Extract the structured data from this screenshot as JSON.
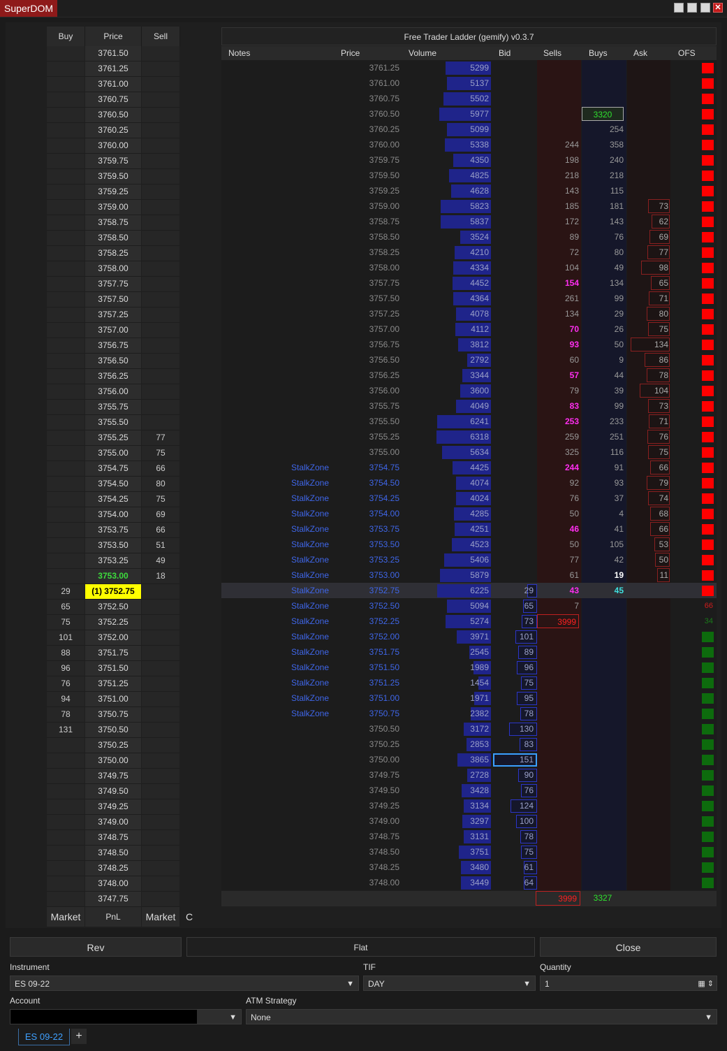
{
  "window": {
    "title": "SuperDOM",
    "ladder_title": "Free Trader Ladder (gemify) v0.3.7"
  },
  "left_ladder": {
    "headers": {
      "buy": "Buy",
      "price": "Price",
      "sell": "Sell"
    },
    "rows": [
      {
        "buy": "",
        "price": "3761.50",
        "sell": ""
      },
      {
        "buy": "",
        "price": "3761.25",
        "sell": ""
      },
      {
        "buy": "",
        "price": "3761.00",
        "sell": ""
      },
      {
        "buy": "",
        "price": "3760.75",
        "sell": ""
      },
      {
        "buy": "",
        "price": "3760.50",
        "sell": ""
      },
      {
        "buy": "",
        "price": "3760.25",
        "sell": ""
      },
      {
        "buy": "",
        "price": "3760.00",
        "sell": ""
      },
      {
        "buy": "",
        "price": "3759.75",
        "sell": ""
      },
      {
        "buy": "",
        "price": "3759.50",
        "sell": ""
      },
      {
        "buy": "",
        "price": "3759.25",
        "sell": ""
      },
      {
        "buy": "",
        "price": "3759.00",
        "sell": ""
      },
      {
        "buy": "",
        "price": "3758.75",
        "sell": ""
      },
      {
        "buy": "",
        "price": "3758.50",
        "sell": ""
      },
      {
        "buy": "",
        "price": "3758.25",
        "sell": ""
      },
      {
        "buy": "",
        "price": "3758.00",
        "sell": ""
      },
      {
        "buy": "",
        "price": "3757.75",
        "sell": ""
      },
      {
        "buy": "",
        "price": "3757.50",
        "sell": ""
      },
      {
        "buy": "",
        "price": "3757.25",
        "sell": ""
      },
      {
        "buy": "",
        "price": "3757.00",
        "sell": ""
      },
      {
        "buy": "",
        "price": "3756.75",
        "sell": ""
      },
      {
        "buy": "",
        "price": "3756.50",
        "sell": ""
      },
      {
        "buy": "",
        "price": "3756.25",
        "sell": ""
      },
      {
        "buy": "",
        "price": "3756.00",
        "sell": ""
      },
      {
        "buy": "",
        "price": "3755.75",
        "sell": ""
      },
      {
        "buy": "",
        "price": "3755.50",
        "sell": ""
      },
      {
        "buy": "",
        "price": "3755.25",
        "sell": "77"
      },
      {
        "buy": "",
        "price": "3755.00",
        "sell": "75"
      },
      {
        "buy": "",
        "price": "3754.75",
        "sell": "66"
      },
      {
        "buy": "",
        "price": "3754.50",
        "sell": "80"
      },
      {
        "buy": "",
        "price": "3754.25",
        "sell": "75"
      },
      {
        "buy": "",
        "price": "3754.00",
        "sell": "69"
      },
      {
        "buy": "",
        "price": "3753.75",
        "sell": "66"
      },
      {
        "buy": "",
        "price": "3753.50",
        "sell": "51"
      },
      {
        "buy": "",
        "price": "3753.25",
        "sell": "49"
      },
      {
        "buy": "",
        "price": "3753.00",
        "sell": "18",
        "style": "last"
      },
      {
        "buy": "29",
        "price": "(1) 3752.75",
        "sell": "",
        "style": "position"
      },
      {
        "buy": "65",
        "price": "3752.50",
        "sell": ""
      },
      {
        "buy": "75",
        "price": "3752.25",
        "sell": ""
      },
      {
        "buy": "101",
        "price": "3752.00",
        "sell": ""
      },
      {
        "buy": "88",
        "price": "3751.75",
        "sell": ""
      },
      {
        "buy": "96",
        "price": "3751.50",
        "sell": ""
      },
      {
        "buy": "76",
        "price": "3751.25",
        "sell": ""
      },
      {
        "buy": "94",
        "price": "3751.00",
        "sell": ""
      },
      {
        "buy": "78",
        "price": "3750.75",
        "sell": ""
      },
      {
        "buy": "131",
        "price": "3750.50",
        "sell": ""
      },
      {
        "buy": "",
        "price": "3750.25",
        "sell": ""
      },
      {
        "buy": "",
        "price": "3750.00",
        "sell": ""
      },
      {
        "buy": "",
        "price": "3749.75",
        "sell": ""
      },
      {
        "buy": "",
        "price": "3749.50",
        "sell": ""
      },
      {
        "buy": "",
        "price": "3749.25",
        "sell": ""
      },
      {
        "buy": "",
        "price": "3749.00",
        "sell": ""
      },
      {
        "buy": "",
        "price": "3748.75",
        "sell": ""
      },
      {
        "buy": "",
        "price": "3748.50",
        "sell": ""
      },
      {
        "buy": "",
        "price": "3748.25",
        "sell": ""
      },
      {
        "buy": "",
        "price": "3748.00",
        "sell": ""
      },
      {
        "buy": "",
        "price": "3747.75",
        "sell": ""
      }
    ],
    "footer": {
      "buy": "Market",
      "pnl": "PnL",
      "sell": "Market",
      "c": "C"
    }
  },
  "right_ladder": {
    "headers": {
      "notes": "Notes",
      "price": "Price",
      "volume": "Volume",
      "bid": "Bid",
      "sells": "Sells",
      "buys": "Buys",
      "ask": "Ask",
      "ofs": "OFS"
    },
    "rows": [
      {
        "note": "",
        "price": "3761.25",
        "volume": 5299,
        "bid": "",
        "sells": "",
        "buys": "",
        "ask": "",
        "ofs": "red"
      },
      {
        "note": "",
        "price": "3761.00",
        "volume": 5137,
        "bid": "",
        "sells": "",
        "buys": "",
        "ask": "",
        "ofs": "red"
      },
      {
        "note": "",
        "price": "3760.75",
        "volume": 5502,
        "bid": "",
        "sells": "",
        "buys": "",
        "ask": "",
        "ofs": "red"
      },
      {
        "note": "",
        "price": "3760.50",
        "volume": 5977,
        "bid": "",
        "sells": "",
        "buys": "3320",
        "ask": "",
        "ofs": "red",
        "buysStyle": "boxgreen"
      },
      {
        "note": "",
        "price": "3760.25",
        "volume": 5099,
        "bid": "",
        "sells": "",
        "buys": "254",
        "ask": "",
        "ofs": "red"
      },
      {
        "note": "",
        "price": "3760.00",
        "volume": 5338,
        "bid": "",
        "sells": "244",
        "buys": "358",
        "ask": "",
        "ofs": "red"
      },
      {
        "note": "",
        "price": "3759.75",
        "volume": 4350,
        "bid": "",
        "sells": "198",
        "buys": "240",
        "ask": "",
        "ofs": "red"
      },
      {
        "note": "",
        "price": "3759.50",
        "volume": 4825,
        "bid": "",
        "sells": "218",
        "buys": "218",
        "ask": "",
        "ofs": "red"
      },
      {
        "note": "",
        "price": "3759.25",
        "volume": 4628,
        "bid": "",
        "sells": "143",
        "buys": "115",
        "ask": "",
        "ofs": "red"
      },
      {
        "note": "",
        "price": "3759.00",
        "volume": 5823,
        "bid": "",
        "sells": "185",
        "buys": "181",
        "ask": "73",
        "ofs": "red"
      },
      {
        "note": "",
        "price": "3758.75",
        "volume": 5837,
        "bid": "",
        "sells": "172",
        "buys": "143",
        "ask": "62",
        "ofs": "red"
      },
      {
        "note": "",
        "price": "3758.50",
        "volume": 3524,
        "bid": "",
        "sells": "89",
        "buys": "76",
        "ask": "69",
        "ofs": "red"
      },
      {
        "note": "",
        "price": "3758.25",
        "volume": 4210,
        "bid": "",
        "sells": "72",
        "buys": "80",
        "ask": "77",
        "ofs": "red"
      },
      {
        "note": "",
        "price": "3758.00",
        "volume": 4334,
        "bid": "",
        "sells": "104",
        "buys": "49",
        "ask": "98",
        "ofs": "red"
      },
      {
        "note": "",
        "price": "3757.75",
        "volume": 4452,
        "bid": "",
        "sells": "154",
        "buys": "134",
        "ask": "65",
        "ofs": "red",
        "sellsStyle": "magenta"
      },
      {
        "note": "",
        "price": "3757.50",
        "volume": 4364,
        "bid": "",
        "sells": "261",
        "buys": "99",
        "ask": "71",
        "ofs": "red"
      },
      {
        "note": "",
        "price": "3757.25",
        "volume": 4078,
        "bid": "",
        "sells": "134",
        "buys": "29",
        "ask": "80",
        "ofs": "red"
      },
      {
        "note": "",
        "price": "3757.00",
        "volume": 4112,
        "bid": "",
        "sells": "70",
        "buys": "26",
        "ask": "75",
        "ofs": "red",
        "sellsStyle": "magenta"
      },
      {
        "note": "",
        "price": "3756.75",
        "volume": 3812,
        "bid": "",
        "sells": "93",
        "buys": "50",
        "ask": "134",
        "ofs": "red",
        "sellsStyle": "magenta"
      },
      {
        "note": "",
        "price": "3756.50",
        "volume": 2792,
        "bid": "",
        "sells": "60",
        "buys": "9",
        "ask": "86",
        "ofs": "red"
      },
      {
        "note": "",
        "price": "3756.25",
        "volume": 3344,
        "bid": "",
        "sells": "57",
        "buys": "44",
        "ask": "78",
        "ofs": "red",
        "sellsStyle": "magenta"
      },
      {
        "note": "",
        "price": "3756.00",
        "volume": 3600,
        "bid": "",
        "sells": "79",
        "buys": "39",
        "ask": "104",
        "ofs": "red"
      },
      {
        "note": "",
        "price": "3755.75",
        "volume": 4049,
        "bid": "",
        "sells": "83",
        "buys": "99",
        "ask": "73",
        "ofs": "red",
        "sellsStyle": "magenta"
      },
      {
        "note": "",
        "price": "3755.50",
        "volume": 6241,
        "bid": "",
        "sells": "253",
        "buys": "233",
        "ask": "71",
        "ofs": "red",
        "sellsStyle": "magenta"
      },
      {
        "note": "",
        "price": "3755.25",
        "volume": 6318,
        "bid": "",
        "sells": "259",
        "buys": "251",
        "ask": "76",
        "ofs": "red"
      },
      {
        "note": "",
        "price": "3755.00",
        "volume": 5634,
        "bid": "",
        "sells": "325",
        "buys": "116",
        "ask": "75",
        "ofs": "red"
      },
      {
        "note": "StalkZone",
        "price": "3754.75",
        "volume": 4425,
        "bid": "",
        "sells": "244",
        "buys": "91",
        "ask": "66",
        "ofs": "red",
        "sellsStyle": "magenta"
      },
      {
        "note": "StalkZone",
        "price": "3754.50",
        "volume": 4074,
        "bid": "",
        "sells": "92",
        "buys": "93",
        "ask": "79",
        "ofs": "red"
      },
      {
        "note": "StalkZone",
        "price": "3754.25",
        "volume": 4024,
        "bid": "",
        "sells": "76",
        "buys": "37",
        "ask": "74",
        "ofs": "red"
      },
      {
        "note": "StalkZone",
        "price": "3754.00",
        "volume": 4285,
        "bid": "",
        "sells": "50",
        "buys": "4",
        "ask": "68",
        "ofs": "red"
      },
      {
        "note": "StalkZone",
        "price": "3753.75",
        "volume": 4251,
        "bid": "",
        "sells": "46",
        "buys": "41",
        "ask": "66",
        "ofs": "red",
        "sellsStyle": "magenta"
      },
      {
        "note": "StalkZone",
        "price": "3753.50",
        "volume": 4523,
        "bid": "",
        "sells": "50",
        "buys": "105",
        "ask": "53",
        "ofs": "red"
      },
      {
        "note": "StalkZone",
        "price": "3753.25",
        "volume": 5406,
        "bid": "",
        "sells": "77",
        "buys": "42",
        "ask": "50",
        "ofs": "red"
      },
      {
        "note": "StalkZone",
        "price": "3753.00",
        "volume": 5879,
        "bid": "",
        "sells": "61",
        "buys": "19",
        "ask": "11",
        "ofs": "red",
        "buysStyle": "white"
      },
      {
        "note": "StalkZone",
        "price": "3752.75",
        "volume": 6225,
        "bid": "29",
        "sells": "43",
        "buys": "45",
        "ask": "",
        "ofs": "red",
        "sellsStyle": "magenta",
        "buysStyle": "cyan",
        "rowStyle": "current"
      },
      {
        "note": "StalkZone",
        "price": "3752.50",
        "volume": 5094,
        "bid": "65",
        "sells": "7",
        "buys": "",
        "ask": "",
        "ofs": "66",
        "ofsColor": "red"
      },
      {
        "note": "StalkZone",
        "price": "3752.25",
        "volume": 5274,
        "bid": "73",
        "sells": "3999",
        "buys": "",
        "ask": "",
        "ofs": "34",
        "ofsColor": "green",
        "sellsStyle": "boxred"
      },
      {
        "note": "StalkZone",
        "price": "3752.00",
        "volume": 3971,
        "bid": "101",
        "sells": "",
        "buys": "",
        "ask": "",
        "ofs": "green"
      },
      {
        "note": "StalkZone",
        "price": "3751.75",
        "volume": 2545,
        "bid": "89",
        "sells": "",
        "buys": "",
        "ask": "",
        "ofs": "green"
      },
      {
        "note": "StalkZone",
        "price": "3751.50",
        "volume": 1989,
        "bid": "96",
        "sells": "",
        "buys": "",
        "ask": "",
        "ofs": "green"
      },
      {
        "note": "StalkZone",
        "price": "3751.25",
        "volume": 1454,
        "bid": "75",
        "sells": "",
        "buys": "",
        "ask": "",
        "ofs": "green"
      },
      {
        "note": "StalkZone",
        "price": "3751.00",
        "volume": 1971,
        "bid": "95",
        "sells": "",
        "buys": "",
        "ask": "",
        "ofs": "green"
      },
      {
        "note": "StalkZone",
        "price": "3750.75",
        "volume": 2382,
        "bid": "78",
        "sells": "",
        "buys": "",
        "ask": "",
        "ofs": "green"
      },
      {
        "note": "",
        "price": "3750.50",
        "volume": 3172,
        "bid": "130",
        "sells": "",
        "buys": "",
        "ask": "",
        "ofs": "green"
      },
      {
        "note": "",
        "price": "3750.25",
        "volume": 2853,
        "bid": "83",
        "sells": "",
        "buys": "",
        "ask": "",
        "ofs": "green"
      },
      {
        "note": "",
        "price": "3750.00",
        "volume": 3865,
        "bid": "151",
        "sells": "",
        "buys": "",
        "ask": "",
        "ofs": "green",
        "bidStyle": "highlight"
      },
      {
        "note": "",
        "price": "3749.75",
        "volume": 2728,
        "bid": "90",
        "sells": "",
        "buys": "",
        "ask": "",
        "ofs": "green"
      },
      {
        "note": "",
        "price": "3749.50",
        "volume": 3428,
        "bid": "76",
        "sells": "",
        "buys": "",
        "ask": "",
        "ofs": "green"
      },
      {
        "note": "",
        "price": "3749.25",
        "volume": 3134,
        "bid": "124",
        "sells": "",
        "buys": "",
        "ask": "",
        "ofs": "green"
      },
      {
        "note": "",
        "price": "3749.00",
        "volume": 3297,
        "bid": "100",
        "sells": "",
        "buys": "",
        "ask": "",
        "ofs": "green"
      },
      {
        "note": "",
        "price": "3748.75",
        "volume": 3131,
        "bid": "78",
        "sells": "",
        "buys": "",
        "ask": "",
        "ofs": "green"
      },
      {
        "note": "",
        "price": "3748.50",
        "volume": 3751,
        "bid": "75",
        "sells": "",
        "buys": "",
        "ask": "",
        "ofs": "green"
      },
      {
        "note": "",
        "price": "3748.25",
        "volume": 3480,
        "bid": "61",
        "sells": "",
        "buys": "",
        "ask": "",
        "ofs": "green"
      },
      {
        "note": "",
        "price": "3748.00",
        "volume": 3449,
        "bid": "64",
        "sells": "",
        "buys": "",
        "ask": "",
        "ofs": "green"
      }
    ],
    "totals": {
      "sells": "3999",
      "buys": "3327"
    }
  },
  "buttons": {
    "rev": "Rev",
    "flat": "Flat",
    "close": "Close"
  },
  "form": {
    "instrument_label": "Instrument",
    "instrument_value": "ES 09-22",
    "tif_label": "TIF",
    "tif_value": "DAY",
    "quantity_label": "Quantity",
    "quantity_value": "1",
    "account_label": "Account",
    "account_value": "",
    "atm_label": "ATM Strategy",
    "atm_value": "None"
  },
  "tabs": [
    {
      "label": "ES 09-22"
    }
  ],
  "colors": {
    "ofs_red": "#ff0000",
    "ofs_green": "#0d6b0d",
    "note_blue": "#3f66e8",
    "volume_bar": "#1f248a",
    "magenta": "#ff2ef0",
    "position_yellow": "#ffff00",
    "last_green": "#3ddc3d",
    "title_red": "#8e1a1a"
  }
}
